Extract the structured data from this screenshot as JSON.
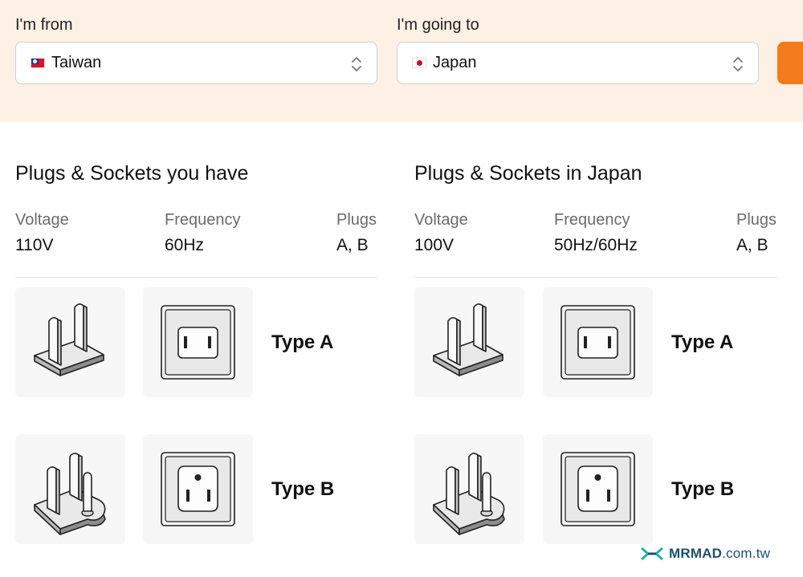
{
  "selector": {
    "from_label": "I'm from",
    "from_value": "Taiwan",
    "to_label": "I'm going to",
    "to_value": "Japan"
  },
  "left": {
    "title": "Plugs & Sockets you have",
    "voltage_label": "Voltage",
    "voltage": "110V",
    "frequency_label": "Frequency",
    "frequency": "60Hz",
    "plugs_label": "Plugs",
    "plugs": "A, B",
    "types": [
      "Type A",
      "Type B"
    ]
  },
  "right": {
    "title": "Plugs & Sockets in Japan",
    "voltage_label": "Voltage",
    "voltage": "100V",
    "frequency_label": "Frequency",
    "frequency": "50Hz/60Hz",
    "plugs_label": "Plugs",
    "plugs": "A, B",
    "types": [
      "Type A",
      "Type B"
    ]
  },
  "watermark": {
    "brand": "MRMAD",
    "domain": ".com.tw"
  },
  "colors": {
    "band": "#fdf1e6",
    "accent": "#f47b1b",
    "tile": "#f7f7f7"
  }
}
